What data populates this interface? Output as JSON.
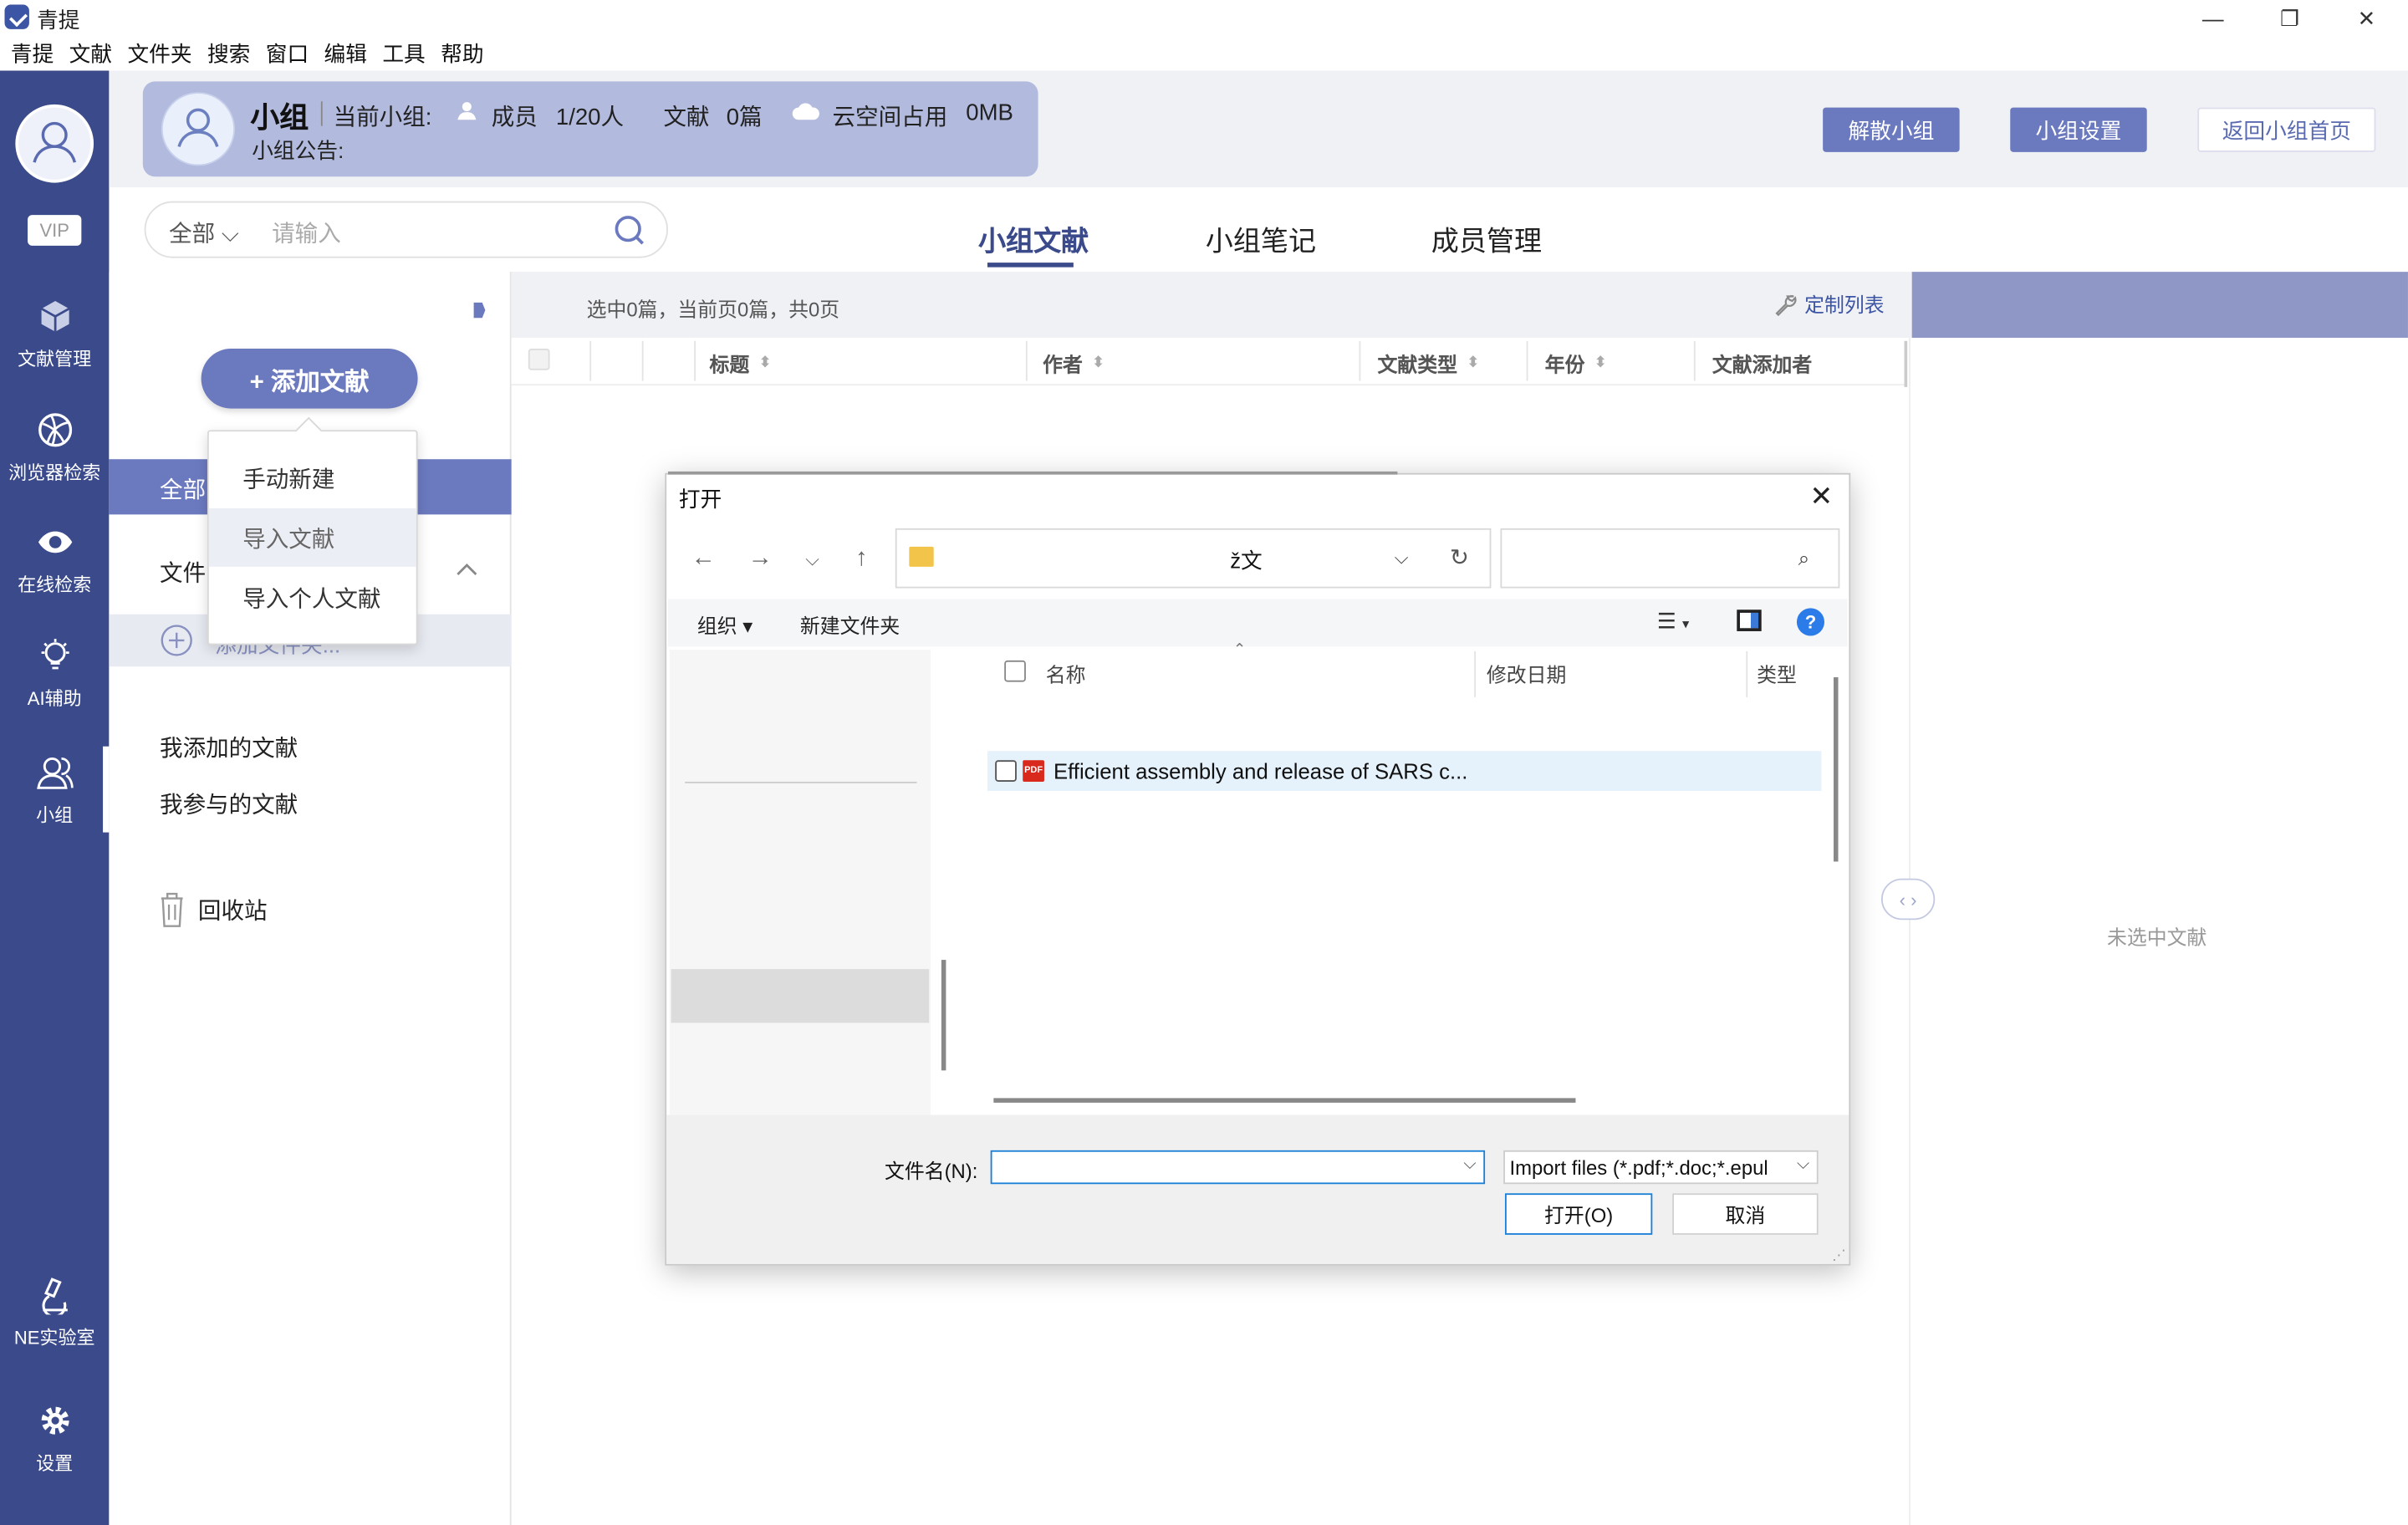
{
  "window": {
    "title": "青提",
    "minimize": "—",
    "maximize": "❐",
    "close": "✕"
  },
  "menubar": [
    "青提",
    "文献",
    "文件夹",
    "搜索",
    "窗口",
    "编辑",
    "工具",
    "帮助"
  ],
  "rail": {
    "vip": "VIP",
    "items": [
      {
        "label": "文献管理",
        "icon": "package-icon"
      },
      {
        "label": "浏览器检索",
        "icon": "globe-icon"
      },
      {
        "label": "在线检索",
        "icon": "eye-icon"
      },
      {
        "label": "AI辅助",
        "icon": "bulb-icon"
      },
      {
        "label": "小组",
        "icon": "group-icon"
      },
      {
        "label": "NE实验室",
        "icon": "microscope-icon"
      },
      {
        "label": "设置",
        "icon": "gear-icon"
      }
    ],
    "active": "小组"
  },
  "group": {
    "name": "小组",
    "current_label": "当前小组:",
    "members_label": "成员",
    "members_value": "1/20人",
    "docs_label": "文献",
    "docs_value": "0篇",
    "storage_label": "云空间占用",
    "storage_value": "0MB",
    "notice_label": "小组公告:"
  },
  "header_buttons": {
    "dissolve": "解散小组",
    "settings": "小组设置",
    "back": "返回小组首页"
  },
  "search": {
    "scope": "全部",
    "placeholder": "请输入"
  },
  "tabs": [
    "小组文献",
    "小组笔记",
    "成员管理"
  ],
  "active_tab": "小组文献",
  "left": {
    "add_button": "+ 添加文献",
    "all": "全部",
    "folder": "文件",
    "add_folder": "添加文件夹...",
    "my_added": "我添加的文献",
    "my_joined": "我参与的文献",
    "trash": "回收站"
  },
  "popup_menu": [
    "手动新建",
    "导入文献",
    "导入个人文献"
  ],
  "popup_hovered": "导入文献",
  "main": {
    "selection_info": "选中0篇，当前页0篇，共0页",
    "custom_list": "定制列表",
    "columns": [
      "标题",
      "作者",
      "文献类型",
      "年份",
      "文献添加者"
    ]
  },
  "right": {
    "empty_text": "未选中文献"
  },
  "dialog": {
    "title": "打开",
    "address": "ž文",
    "toolbar": {
      "organize": "组织 ▾",
      "new_folder": "新建文件夹"
    },
    "columns": [
      "名称",
      "修改日期",
      "类型"
    ],
    "files": [
      {
        "name": "Efficient assembly and release of SARS c...",
        "type_icon": "pdf-icon"
      }
    ],
    "filename_label": "文件名(N):",
    "filename_value": "",
    "filetype": "Import files (*.pdf;*.doc;*.epul",
    "open_button": "打开(O)",
    "cancel_button": "取消"
  },
  "colors": {
    "rail": "#3a4a8a",
    "accent": "#6b79bf",
    "group_card": "#b2bade",
    "right_top": "#8e97c6"
  }
}
